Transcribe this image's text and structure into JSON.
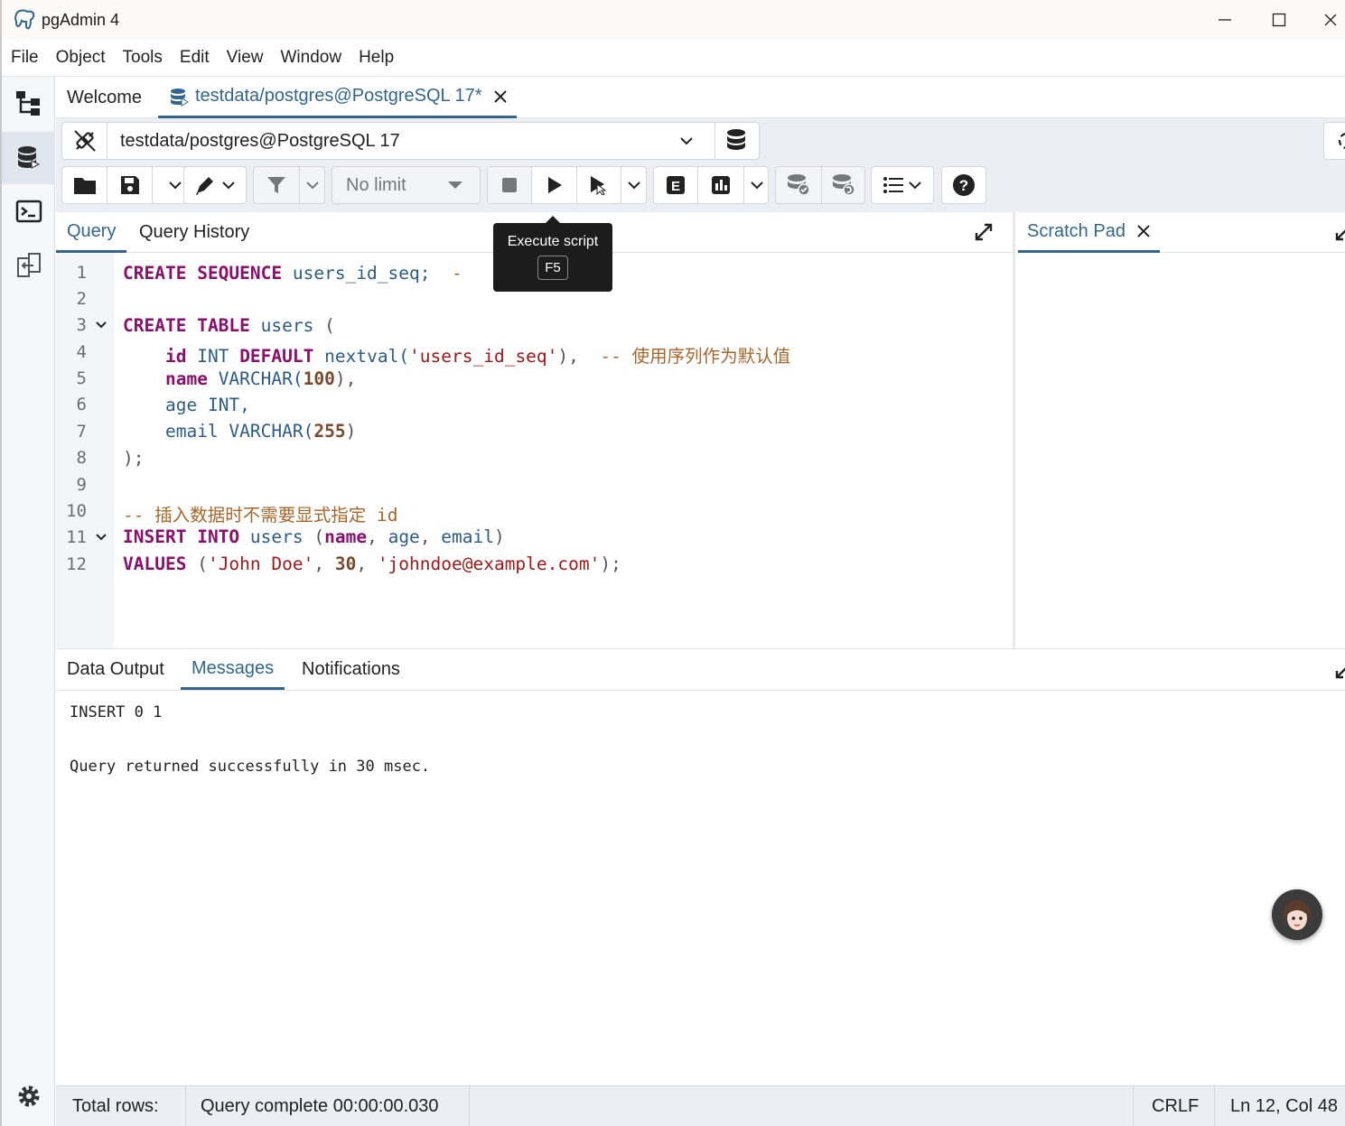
{
  "window": {
    "title": "pgAdmin 4"
  },
  "menu": [
    "File",
    "Object",
    "Tools",
    "Edit",
    "View",
    "Window",
    "Help"
  ],
  "tabs": {
    "welcome": "Welcome",
    "query_tool": "testdata/postgres@PostgreSQL 17*"
  },
  "connection": {
    "selected": "testdata/postgres@PostgreSQL 17"
  },
  "toolbar": {
    "limit": "No limit"
  },
  "tooltip": {
    "title": "Execute script",
    "shortcut": "F5"
  },
  "editor_tabs": {
    "query": "Query",
    "history": "Query History"
  },
  "scratch": {
    "title": "Scratch Pad"
  },
  "code_lines": [
    "1",
    "2",
    "3",
    "4",
    "5",
    "6",
    "7",
    "8",
    "9",
    "10",
    "11",
    "12"
  ],
  "code": {
    "l1": [
      "CREATE",
      "SEQUENCE",
      "users_id_seq;",
      "-"
    ],
    "l3": [
      "CREATE",
      "TABLE",
      "users",
      "("
    ],
    "l4": [
      "id",
      "INT",
      "DEFAULT",
      "nextval(",
      "'users_id_seq'",
      "),",
      "-- 使用序列作为默认值"
    ],
    "l5": [
      "name",
      "VARCHAR(",
      "100",
      "),"
    ],
    "l6": [
      "age",
      "INT,"
    ],
    "l7": [
      "email",
      "VARCHAR(",
      "255",
      ")"
    ],
    "l8": [
      ");"
    ],
    "l10": [
      "-- 插入数据时不需要显式指定 id"
    ],
    "l11": [
      "INSERT",
      "INTO",
      "users",
      "(",
      "name",
      ", ",
      "age",
      ", ",
      "email",
      ")"
    ],
    "l12": [
      "VALUES",
      "(",
      "'John Doe'",
      ", ",
      "30",
      ", ",
      "'johndoe@example.com'",
      ");"
    ]
  },
  "results": {
    "tabs": [
      "Data Output",
      "Messages",
      "Notifications"
    ],
    "messages": [
      "INSERT 0 1",
      "Query returned successfully in 30 msec."
    ]
  },
  "status": {
    "total_rows": "Total rows:",
    "query_status": "Query complete 00:00:00.030",
    "eol": "CRLF",
    "position": "Ln 12, Col 48"
  },
  "colors": {
    "accent": "#326690",
    "keyword": "#8a0f6e",
    "string": "#a01818",
    "comment": "#a8662a"
  }
}
